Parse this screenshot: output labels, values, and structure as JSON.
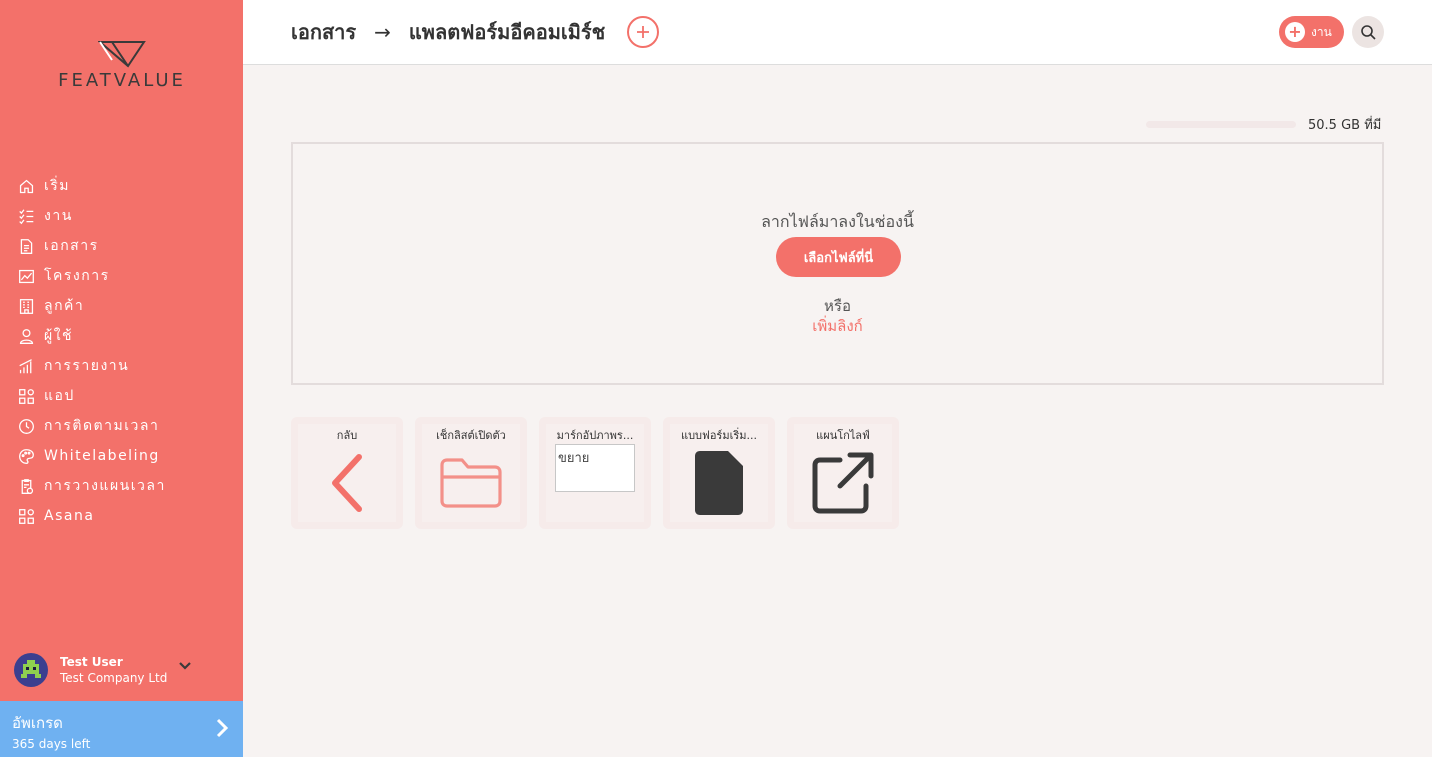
{
  "brand": {
    "logo_text": "FEATVALUE",
    "accent": "#f3716a",
    "upgrade_color": "#6fb1f1"
  },
  "sidebar": {
    "items": [
      {
        "label": "เริ่ม",
        "icon": "home-icon"
      },
      {
        "label": "งาน",
        "icon": "checklist-icon"
      },
      {
        "label": "เอกสาร",
        "icon": "document-icon"
      },
      {
        "label": "โครงการ",
        "icon": "chart-icon"
      },
      {
        "label": "ลูกค้า",
        "icon": "building-icon"
      },
      {
        "label": "ผู้ใช้",
        "icon": "user-icon"
      },
      {
        "label": "การรายงาน",
        "icon": "bar-chart-icon"
      },
      {
        "label": "แอป",
        "icon": "apps-icon"
      },
      {
        "label": "การติดตามเวลา",
        "icon": "timer-icon"
      },
      {
        "label": "Whitelabeling",
        "icon": "palette-icon"
      },
      {
        "label": "การวางแผนเวลา",
        "icon": "clipboard-clock-icon"
      },
      {
        "label": "Asana",
        "icon": "apps-icon"
      }
    ],
    "user": {
      "name": "Test User",
      "company": "Test Company Ltd"
    },
    "upgrade": {
      "title": "อัพเกรด",
      "days_left": "365 days left"
    }
  },
  "header": {
    "breadcrumb": [
      "เอกสาร",
      "แพลตฟอร์มอีคอมเมิร์ช"
    ],
    "separator": "→",
    "task_button_label": "งาน"
  },
  "storage": {
    "text": "50.5 GB ที่มี",
    "used_fraction": 0.0
  },
  "dropzone": {
    "title": "ลากไฟล์มาลงในช่องนี้",
    "choose_button": "เลือกไฟล์ที่นี่",
    "or_text": "หรือ",
    "add_link": "เพิ่มลิงก์"
  },
  "tiles": [
    {
      "label": "กลับ",
      "icon": "chevron-left-icon"
    },
    {
      "label": "เช็กลิสต์เปิดตัว",
      "icon": "folder-icon"
    },
    {
      "label": "มาร์กอัปภาพร...",
      "icon": "broken-image-icon",
      "alt": "ขยาย"
    },
    {
      "label": "แบบฟอร์มเริ่ม...",
      "icon": "file-icon"
    },
    {
      "label": "แผนโกไลฟ์",
      "icon": "external-link-icon"
    }
  ]
}
